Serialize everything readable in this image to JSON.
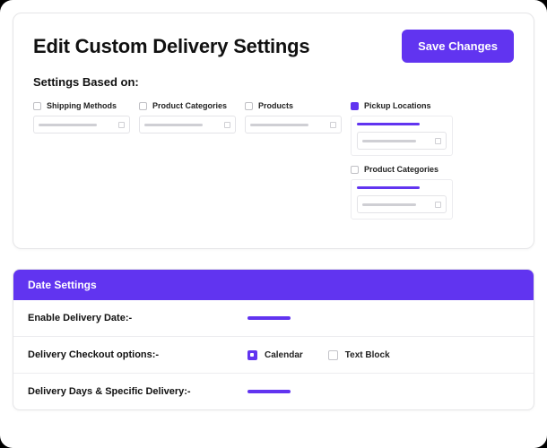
{
  "header": {
    "title": "Edit Custom Delivery Settings",
    "save_label": "Save Changes"
  },
  "settings_based_on": {
    "heading": "Settings Based on:",
    "options": {
      "shipping_methods": {
        "label": "Shipping Methods",
        "checked": false
      },
      "product_categories_1": {
        "label": "Product Categories",
        "checked": false
      },
      "products": {
        "label": "Products",
        "checked": false
      },
      "pickup_locations": {
        "label": "Pickup Locations",
        "checked": true
      },
      "product_categories_2": {
        "label": "Product Categories",
        "checked": false
      }
    }
  },
  "date_settings": {
    "heading": "Date Settings",
    "rows": {
      "enable": "Enable Delivery Date:-",
      "checkout_options": "Delivery Checkout options:-",
      "days_specific": "Delivery Days & Specific Delivery:-"
    },
    "checkout_labels": {
      "calendar": "Calendar",
      "text_block": "Text Block"
    }
  }
}
